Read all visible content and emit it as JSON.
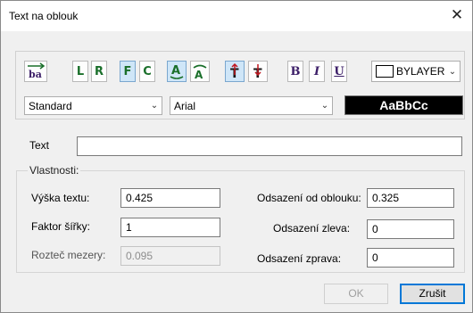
{
  "window": {
    "title": "Text na oblouk",
    "close_glyph": "✕"
  },
  "toolbar": {
    "buttons": [
      {
        "name": "fit-text-icon",
        "top": "ba",
        "active": false
      },
      {
        "name": "align-left-button",
        "label": "L",
        "active": false
      },
      {
        "name": "align-right-button",
        "label": "R",
        "active": false
      },
      {
        "name": "fit-button",
        "label": "F",
        "active": true
      },
      {
        "name": "center-button",
        "label": "C",
        "active": false
      },
      {
        "name": "convex-side-icon",
        "label": "A",
        "active": true
      },
      {
        "name": "concave-side-icon",
        "label": "A",
        "active": false
      },
      {
        "name": "outward-direction-icon",
        "label": "T",
        "active": true
      },
      {
        "name": "inward-direction-icon",
        "label": "T",
        "active": false
      },
      {
        "name": "bold-button",
        "label": "B",
        "active": false
      },
      {
        "name": "italic-button",
        "label": "I",
        "active": false
      },
      {
        "name": "underline-button",
        "label": "U",
        "active": false
      }
    ],
    "color_label": "BYLAYER",
    "style_value": "Standard",
    "font_value": "Arial",
    "preview_text": "AaBbCc"
  },
  "text_field": {
    "label": "Text",
    "value": ""
  },
  "properties": {
    "title": "Vlastnosti:",
    "text_height_label": "Výška textu:",
    "text_height_value": "0.425",
    "width_factor_label": "Faktor šířky:",
    "width_factor_value": "1",
    "char_spacing_label": "Rozteč mezery:",
    "char_spacing_value": "0.095",
    "arc_offset_label": "Odsazení od oblouku:",
    "arc_offset_value": "0.325",
    "left_offset_label": "Odsazení zleva:",
    "left_offset_value": "0",
    "right_offset_label": "Odsazení zprava:",
    "right_offset_value": "0"
  },
  "buttons": {
    "ok_label": "OK",
    "cancel_label": "Zrušit"
  },
  "colors": {
    "accent": "#0078d7",
    "active_button_bg": "#cfe6f8",
    "preview_bg": "#000000"
  }
}
